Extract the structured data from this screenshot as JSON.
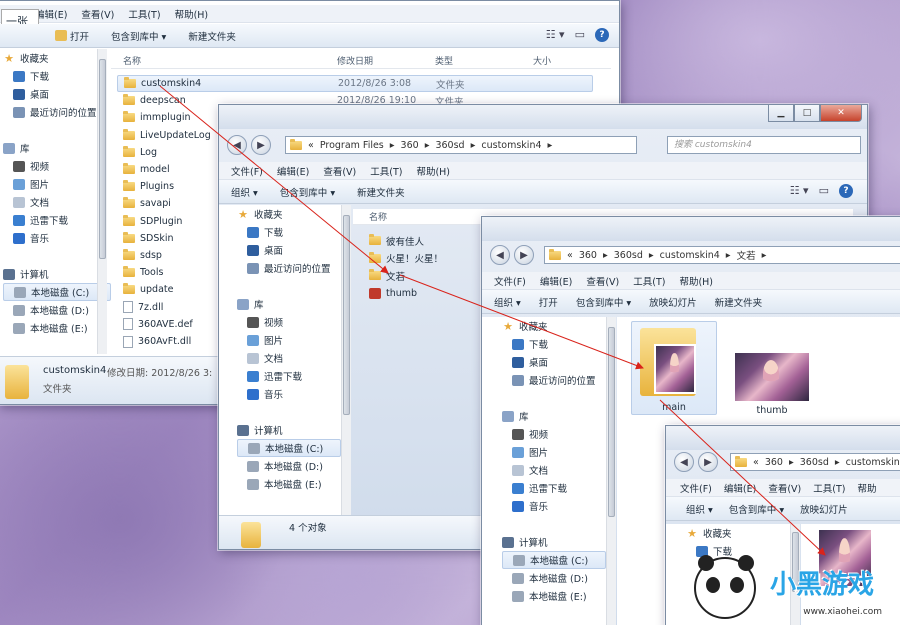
{
  "note_label": "一张",
  "win1": {
    "menu": [
      "编辑(E)",
      "查看(V)",
      "工具(T)",
      "帮助(H)"
    ],
    "toolbar": [
      "打开",
      "包含到库中 ▾",
      "新建文件夹"
    ],
    "headers": {
      "name": "名称",
      "date": "修改日期",
      "type": "类型",
      "size": "大小"
    },
    "nav": [
      "收藏夹",
      "下载",
      "桌面",
      "最近访问的位置",
      "",
      "库",
      "视频",
      "图片",
      "文档",
      "迅雷下载",
      "音乐",
      "",
      "计算机",
      "本地磁盘 (C:)",
      "本地磁盘 (D:)",
      "本地磁盘 (E:)"
    ],
    "files": [
      {
        "name": "customskin4",
        "date": "2012/8/26 3:08",
        "type": "文件夹",
        "kind": "folder"
      },
      {
        "name": "deepscan",
        "date": "2012/8/26 19:10",
        "type": "文件夹",
        "kind": "folder"
      },
      {
        "name": "immplugin",
        "date": "",
        "type": "",
        "kind": "folder"
      },
      {
        "name": "LiveUpdateLog",
        "date": "",
        "type": "",
        "kind": "folder"
      },
      {
        "name": "Log",
        "date": "",
        "type": "",
        "kind": "folder"
      },
      {
        "name": "model",
        "date": "",
        "type": "",
        "kind": "folder"
      },
      {
        "name": "Plugins",
        "date": "",
        "type": "",
        "kind": "folder"
      },
      {
        "name": "savapi",
        "date": "",
        "type": "",
        "kind": "folder"
      },
      {
        "name": "SDPlugin",
        "date": "",
        "type": "",
        "kind": "folder"
      },
      {
        "name": "SDSkin",
        "date": "",
        "type": "",
        "kind": "folder"
      },
      {
        "name": "sdsp",
        "date": "",
        "type": "",
        "kind": "folder"
      },
      {
        "name": "Tools",
        "date": "",
        "type": "",
        "kind": "folder"
      },
      {
        "name": "update",
        "date": "",
        "type": "",
        "kind": "folder"
      },
      {
        "name": "7z.dll",
        "date": "",
        "type": "",
        "kind": "file"
      },
      {
        "name": "360AVE.def",
        "date": "",
        "type": "",
        "kind": "file"
      },
      {
        "name": "360AvFt.dll",
        "date": "",
        "type": "",
        "kind": "file"
      }
    ],
    "status_name": "customskin4",
    "status_detail": "修改日期: 2012/8/26 3:",
    "status_type": "文件夹"
  },
  "win2": {
    "path": [
      "«",
      "Program Files",
      "▸",
      "360",
      "▸",
      "360sd",
      "▸",
      "customskin4",
      "▸"
    ],
    "search_placeholder": "搜索 customskin4",
    "menu": [
      "文件(F)",
      "编辑(E)",
      "查看(V)",
      "工具(T)",
      "帮助(H)"
    ],
    "toolbar": [
      "组织 ▾",
      "包含到库中 ▾",
      "新建文件夹"
    ],
    "header_name": "名称",
    "nav": [
      "收藏夹",
      "下载",
      "桌面",
      "最近访问的位置",
      "",
      "库",
      "视频",
      "图片",
      "文档",
      "迅雷下载",
      "音乐",
      "",
      "计算机",
      "本地磁盘 (C:)",
      "本地磁盘 (D:)",
      "本地磁盘 (E:)"
    ],
    "files": [
      {
        "name": "彼有佳人",
        "kind": "folder"
      },
      {
        "name": "火星！火星！",
        "kind": "folder"
      },
      {
        "name": "文若",
        "kind": "folder"
      },
      {
        "name": "thumb",
        "kind": "img"
      }
    ],
    "status": "4 个对象"
  },
  "win3": {
    "path": [
      "«",
      "360",
      "▸",
      "360sd",
      "▸",
      "customskin4",
      "▸",
      "文若",
      "▸"
    ],
    "menu": [
      "文件(F)",
      "编辑(E)",
      "查看(V)",
      "工具(T)",
      "帮助(H)"
    ],
    "toolbar": [
      "组织 ▾",
      "打开",
      "包含到库中 ▾",
      "放映幻灯片",
      "新建文件夹"
    ],
    "nav": [
      "收藏夹",
      "下载",
      "桌面",
      "最近访问的位置",
      "",
      "库",
      "视频",
      "图片",
      "文档",
      "迅雷下载",
      "音乐",
      "",
      "计算机",
      "本地磁盘 (C:)",
      "本地磁盘 (D:)",
      "本地磁盘 (E:)"
    ],
    "tiles": [
      "main",
      "thumb"
    ]
  },
  "win4": {
    "path": [
      "«",
      "360",
      "▸",
      "360sd",
      "▸",
      "customskin"
    ],
    "menu": [
      "文件(F)",
      "编辑(E)",
      "查看(V)",
      "工具(T)",
      "帮助"
    ],
    "toolbar": [
      "组织 ▾",
      "包含到库中 ▾",
      "放映幻灯片"
    ],
    "nav": [
      "收藏夹",
      "下载"
    ]
  },
  "watermark": {
    "text": "小黑游戏",
    "url": "www.xiaohei.com"
  }
}
